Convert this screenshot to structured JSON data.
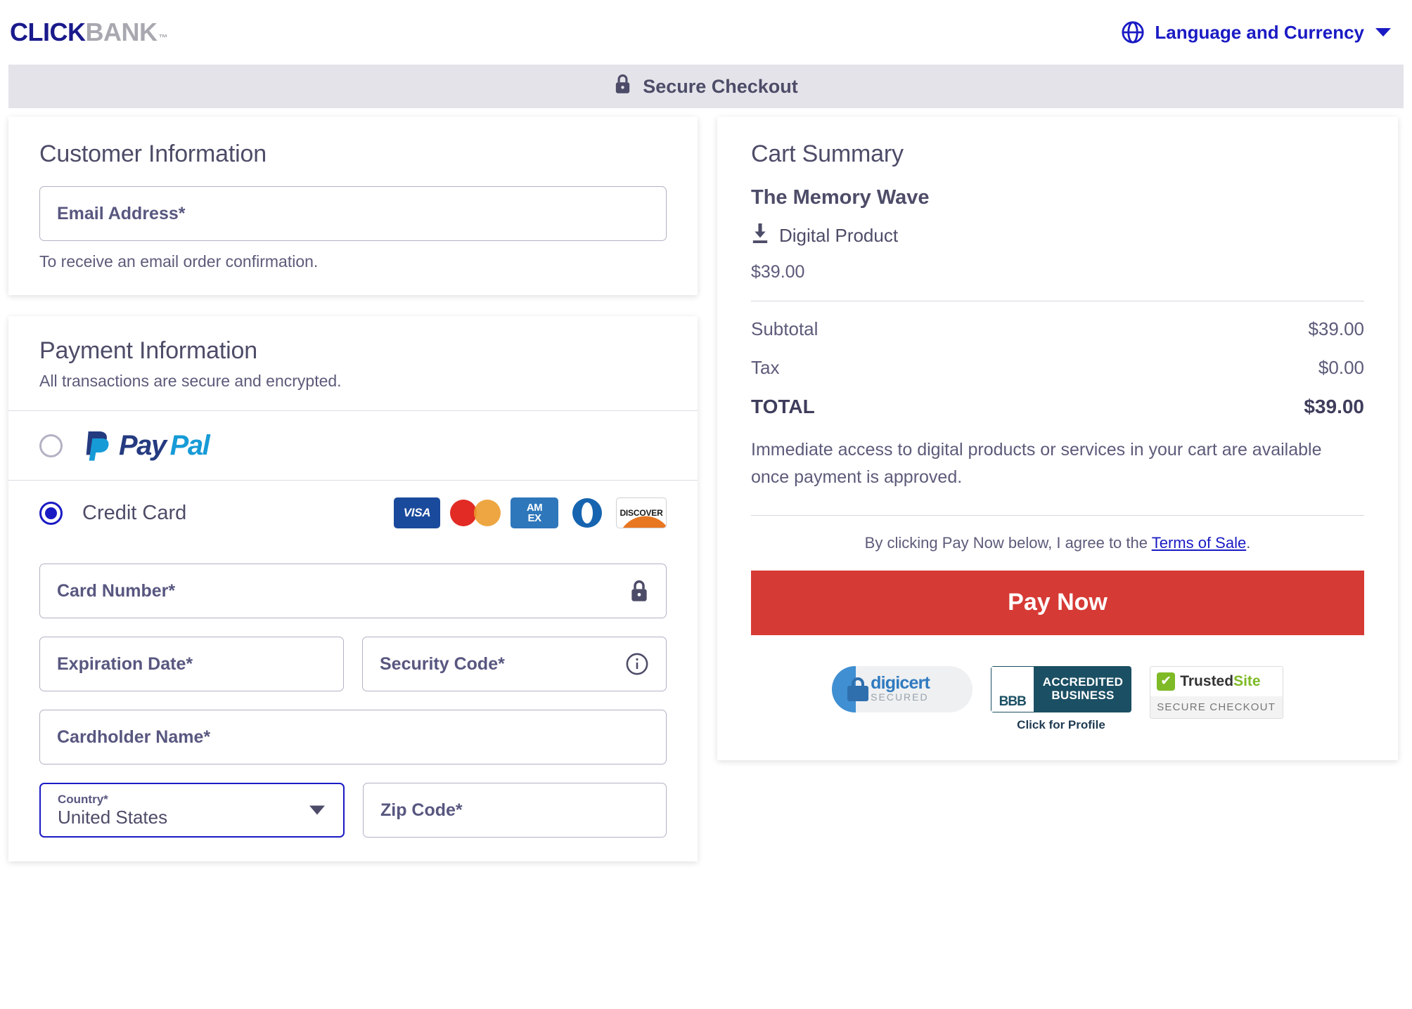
{
  "brand": {
    "logo_primary": "CLICK",
    "logo_secondary": "BANK",
    "logo_tm": "™",
    "primary_color": "#1a1ac4",
    "accent_color": "#d63a35"
  },
  "header": {
    "language_label": "Language and Currency",
    "globe_icon": "globe-icon",
    "caret_icon": "chevron-down-icon"
  },
  "secure_bar": {
    "label": "Secure Checkout",
    "lock_icon": "lock-icon"
  },
  "customer": {
    "title": "Customer Information",
    "email_placeholder": "Email Address*",
    "email_value": "",
    "helper": "To receive an email order confirmation."
  },
  "payment": {
    "title": "Payment Information",
    "subtitle": "All transactions are secure and encrypted.",
    "methods": [
      {
        "id": "paypal",
        "label": "PayPal",
        "selected": false
      },
      {
        "id": "credit-card",
        "label": "Credit Card",
        "selected": true
      }
    ],
    "card_brands": [
      "VISA",
      "Mastercard",
      "AMEX",
      "Diners Club",
      "DISCOVER"
    ],
    "amex_line1": "AM",
    "amex_line2": "EX",
    "visa_text": "VISA",
    "discover_text": "DISCOVER",
    "fields": {
      "card_number_placeholder": "Card Number*",
      "card_number_value": "",
      "expiration_placeholder": "Expiration Date*",
      "expiration_value": "",
      "security_code_placeholder": "Security Code*",
      "security_code_value": "",
      "cardholder_placeholder": "Cardholder Name*",
      "cardholder_value": "",
      "country_label": "Country*",
      "country_value": "United States",
      "zip_placeholder": "Zip Code*",
      "zip_value": ""
    }
  },
  "cart": {
    "title": "Cart Summary",
    "product_name": "The Memory Wave",
    "product_type": "Digital Product",
    "download_icon": "download-icon",
    "product_price": "$39.00",
    "subtotal_label": "Subtotal",
    "subtotal_value": "$39.00",
    "tax_label": "Tax",
    "tax_value": "$0.00",
    "total_label": "TOTAL",
    "total_value": "$39.00",
    "note": "Immediate access to digital products or services in your cart are available once payment is approved.",
    "agree_prefix": "By clicking Pay Now below, I agree to the ",
    "agree_link": "Terms of Sale",
    "agree_suffix": ".",
    "pay_button": "Pay Now"
  },
  "badges": {
    "digicert_name": "digicert",
    "digicert_sub": "SECURED",
    "bbb_abbr": "BBB",
    "bbb_line1": "ACCREDITED",
    "bbb_line2": "BUSINESS",
    "bbb_cta": "Click for Profile",
    "trusted_name_1": "Trusted",
    "trusted_name_2": "Site",
    "trusted_sub": "SECURE CHECKOUT",
    "check_glyph": "✔"
  }
}
